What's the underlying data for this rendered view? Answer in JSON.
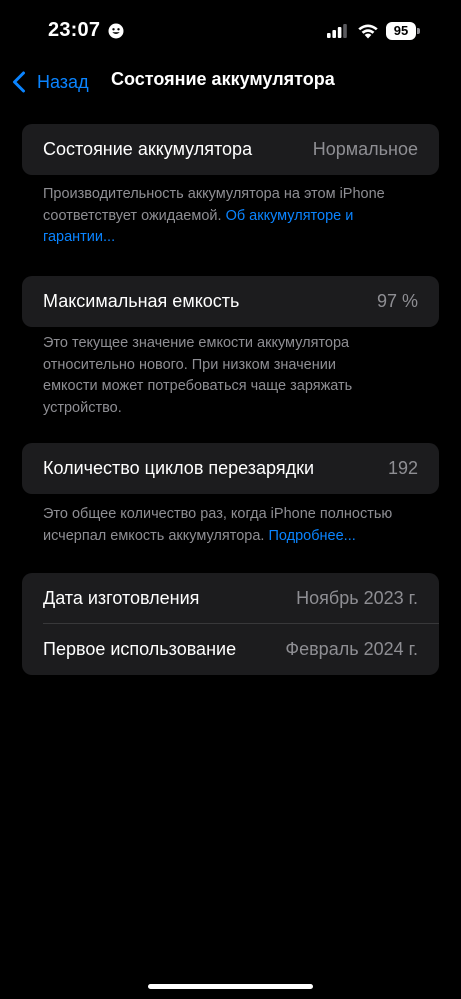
{
  "status_bar": {
    "time": "23:07",
    "battery_level": "95",
    "focus_icon": "smiley-face-icon",
    "signal_icon": "cellular-signal-icon",
    "wifi_icon": "wifi-icon"
  },
  "nav": {
    "back_label": "Назад",
    "back_icon": "chevron-left-icon",
    "title": "Состояние аккумулятора"
  },
  "battery_health": {
    "label": "Состояние аккумулятора",
    "value": "Нормальное",
    "footnote_text": "Производительность аккумулятора на этом iPhone соответствует ожидаемой.",
    "footnote_link": "Об аккумуляторе и гарантии..."
  },
  "max_capacity": {
    "label": "Максимальная емкость",
    "value": "97 %",
    "footnote_text": "Это текущее значение емкости аккумулятора относительно нового. При низком значении емкости может потребоваться чаще заряжать устройство."
  },
  "cycle_count": {
    "label": "Количество циклов перезарядки",
    "value": "192",
    "footnote_text": "Это общее количество раз, когда iPhone полностью исчерпал емкость аккумулятора.",
    "footnote_link": "Подробнее..."
  },
  "dates": {
    "manufacture_label": "Дата изготовления",
    "manufacture_value": "Ноябрь 2023 г.",
    "first_use_label": "Первое использование",
    "first_use_value": "Февраль 2024 г."
  },
  "colors": {
    "background": "#000000",
    "card": "#1c1c1e",
    "accent": "#0a84ff",
    "secondary_text": "#8e8e93"
  }
}
